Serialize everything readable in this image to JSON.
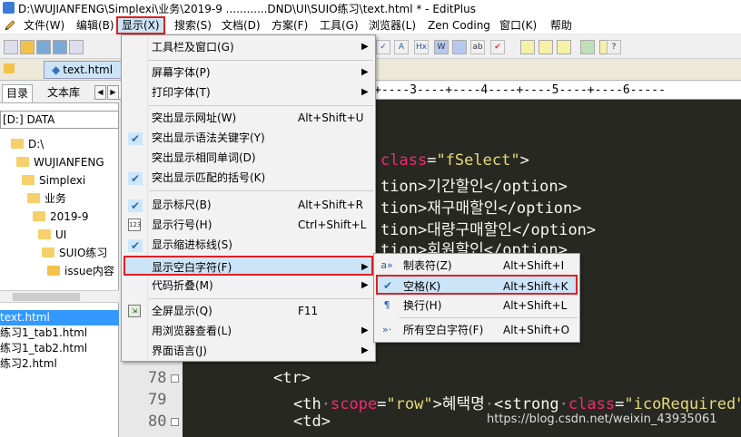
{
  "window": {
    "title": "D:\\WUJIANFENG\\Simplexi\\业务\\2019-9 ............DND\\UI\\SUIO练习\\text.html * - EditPlus"
  },
  "menubar": {
    "items": [
      "文件(W)",
      "编辑(B)",
      "显示(X)",
      "搜索(S)",
      "文档(D)",
      "方案(F)",
      "工具(G)",
      "浏览器(L)",
      "Zen Coding",
      "窗口(K)",
      "帮助"
    ]
  },
  "tabs": {
    "file_tab": "text.html"
  },
  "left_panel": {
    "tab_directory": "目录",
    "tab_library": "文本库",
    "drive": "[D:] DATA",
    "tree": [
      "D:\\",
      "WUJIANFENG",
      "Simplexi",
      "业务",
      "2019-9",
      "UI",
      "SUIO练习",
      "issue内容"
    ],
    "files": [
      "text.html",
      "练习1_tab1.html",
      "练习1_tab2.html",
      "练习2.html"
    ]
  },
  "ruler": {
    "text": "+----3----+----4----+----5----+----6-----"
  },
  "view_menu": {
    "items": [
      {
        "label": "工具栏及窗口(G)",
        "shortcut": "",
        "submenu": true,
        "checked": false
      },
      {
        "label": "屏幕字体(P)",
        "shortcut": "",
        "submenu": true,
        "checked": false
      },
      {
        "label": "打印字体(T)",
        "shortcut": "",
        "submenu": true,
        "checked": false
      },
      {
        "label": "突出显示网址(W)",
        "shortcut": "Alt+Shift+U",
        "submenu": false,
        "checked": false
      },
      {
        "label": "突出显示语法关键字(Y)",
        "shortcut": "",
        "submenu": false,
        "checked": true
      },
      {
        "label": "突出显示相同单词(D)",
        "shortcut": "",
        "submenu": false,
        "checked": false
      },
      {
        "label": "突出显示匹配的括号(K)",
        "shortcut": "",
        "submenu": false,
        "checked": true
      },
      {
        "label": "显示标尺(B)",
        "shortcut": "Alt+Shift+R",
        "submenu": false,
        "checked": true
      },
      {
        "label": "显示行号(H)",
        "shortcut": "Ctrl+Shift+L",
        "submenu": false,
        "checked": false
      },
      {
        "label": "显示缩进标线(S)",
        "shortcut": "",
        "submenu": false,
        "checked": true
      },
      {
        "label": "显示空白字符(F)",
        "shortcut": "",
        "submenu": true,
        "checked": false
      },
      {
        "label": "代码折叠(M)",
        "shortcut": "",
        "submenu": true,
        "checked": false
      },
      {
        "label": "全屏显示(Q)",
        "shortcut": "F11",
        "submenu": false,
        "checked": false
      },
      {
        "label": "用浏览器查看(L)",
        "shortcut": "",
        "submenu": true,
        "checked": false
      },
      {
        "label": "界面语言(J)",
        "shortcut": "",
        "submenu": true,
        "checked": false
      }
    ]
  },
  "whitespace_submenu": {
    "items": [
      {
        "label": "制表符(Z)",
        "shortcut": "Alt+Shift+I"
      },
      {
        "label": "空格(K)",
        "shortcut": "Alt+Shift+K"
      },
      {
        "label": "换行(H)",
        "shortcut": "Alt+Shift+L"
      },
      {
        "label": "所有空白字符(F)",
        "shortcut": "Alt+Shift+O"
      }
    ]
  },
  "editor": {
    "line_numbers": [
      "78",
      "79",
      "80"
    ],
    "lines": [
      {
        "parts": [
          [
            "c-attr",
            "class"
          ],
          [
            "c-txt",
            "="
          ],
          [
            "c-str",
            "\"fSelect\""
          ],
          [
            "c-tag",
            ">"
          ]
        ]
      },
      {
        "parts": [
          [
            "c-tag",
            "tion>"
          ],
          [
            "c-txt",
            "기간할인"
          ],
          [
            "c-tag",
            "</option>"
          ]
        ]
      },
      {
        "parts": [
          [
            "c-tag",
            "tion>"
          ],
          [
            "c-txt",
            "재구매할인"
          ],
          [
            "c-tag",
            "</option>"
          ]
        ]
      },
      {
        "parts": [
          [
            "c-tag",
            "tion>"
          ],
          [
            "c-txt",
            "대량구매할인"
          ],
          [
            "c-tag",
            "</option>"
          ]
        ]
      },
      {
        "parts": [
          [
            "c-tag",
            "tion>"
          ],
          [
            "c-txt",
            "회원할인"
          ],
          [
            "c-tag",
            "</option>"
          ]
        ]
      },
      {
        "parts": [
          [
            "c-tag",
            "<tr>"
          ]
        ]
      },
      {
        "parts": [
          [
            "c-tag",
            "<th"
          ],
          [
            "c-dot",
            "·"
          ],
          [
            "c-attr",
            "scope"
          ],
          [
            "c-txt",
            "="
          ],
          [
            "c-str",
            "\"row\""
          ],
          [
            "c-tag",
            ">"
          ],
          [
            "c-txt",
            "혜택명"
          ],
          [
            "c-dot",
            "·"
          ],
          [
            "c-tag",
            "<strong"
          ],
          [
            "c-dot",
            "·"
          ],
          [
            "c-attr",
            "class"
          ],
          [
            "c-txt",
            "="
          ],
          [
            "c-str",
            "\"icoRequired\""
          ],
          [
            "c-tag",
            ">"
          ]
        ]
      },
      {
        "parts": [
          [
            "c-tag",
            "<td>"
          ]
        ]
      }
    ]
  },
  "watermark": "https://blog.csdn.net/weixin_43935061"
}
